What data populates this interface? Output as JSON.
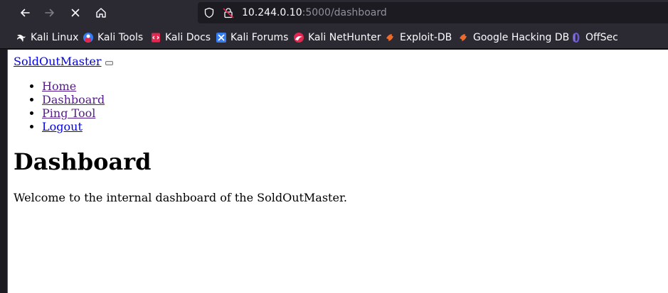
{
  "browser": {
    "url_host": "10.244.0.10",
    "url_rest": ":5000/dashboard",
    "bookmarks": [
      {
        "label": "Kali Linux",
        "icon": "kali-dragon-icon"
      },
      {
        "label": "Kali Tools",
        "icon": "kali-tools-icon"
      },
      {
        "label": "Kali Docs",
        "icon": "kali-docs-icon"
      },
      {
        "label": "Kali Forums",
        "icon": "kali-forums-icon"
      },
      {
        "label": "Kali NetHunter",
        "icon": "nethunter-icon"
      },
      {
        "label": "Exploit-DB",
        "icon": "exploit-db-icon"
      },
      {
        "label": "Google Hacking DB",
        "icon": "ghdb-icon"
      },
      {
        "label": "OffSec",
        "icon": "offsec-icon"
      }
    ]
  },
  "page": {
    "brand": "SoldOutMaster",
    "nav": [
      "Home",
      "Dashboard",
      "Ping Tool",
      "Logout"
    ],
    "heading": "Dashboard",
    "welcome": "Welcome to the internal dashboard of the SoldOutMaster."
  },
  "colors": {
    "chrome_bg": "#2b2a33",
    "urlbar_bg": "#1c1b22",
    "link": "#0000ee",
    "visited_link": "#551a8b"
  }
}
